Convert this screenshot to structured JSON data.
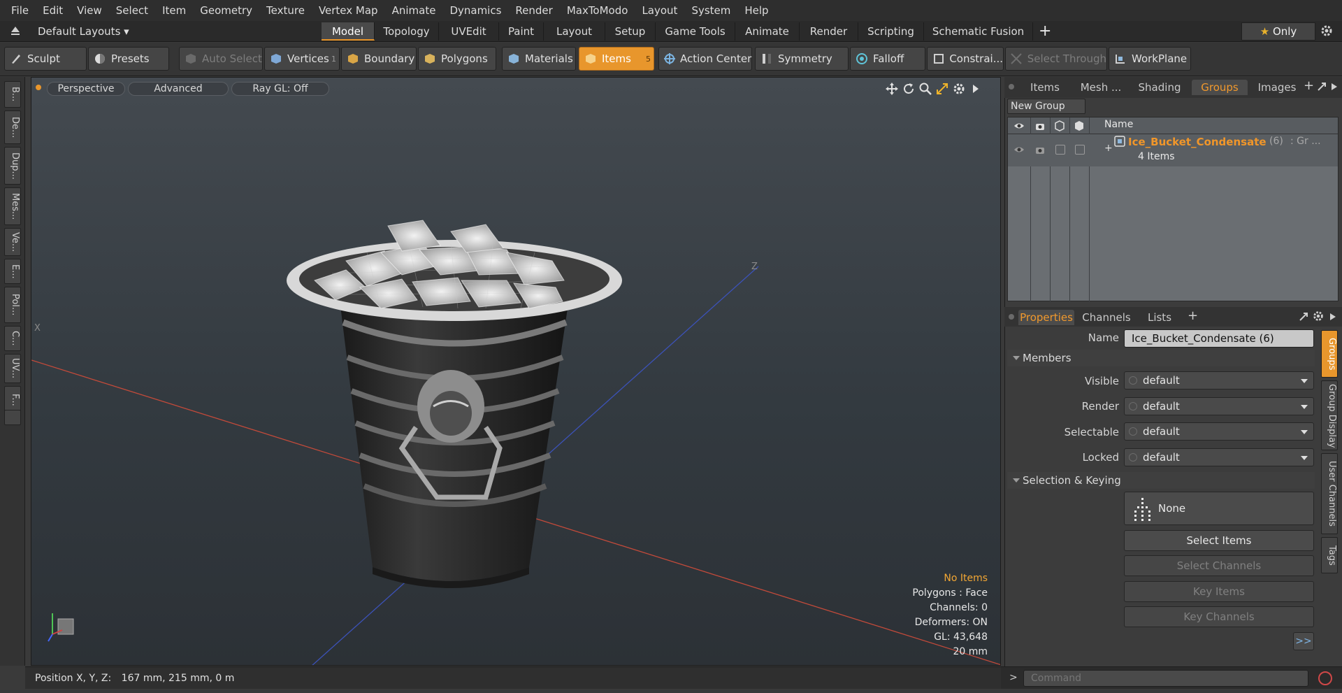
{
  "menu": [
    "File",
    "Edit",
    "View",
    "Select",
    "Item",
    "Geometry",
    "Texture",
    "Vertex Map",
    "Animate",
    "Dynamics",
    "Render",
    "MaxToModo",
    "Layout",
    "System",
    "Help"
  ],
  "tabbar": {
    "layout_label": "Default Layouts",
    "tabs": [
      "Model",
      "Topology",
      "UVEdit",
      "Paint",
      "Layout",
      "Setup",
      "Game Tools",
      "Animate",
      "Render",
      "Scripting",
      "Schematic Fusion"
    ],
    "active_tab": "Model",
    "plus": "+",
    "only_label": "Only"
  },
  "toolbar": {
    "sculpt": "Sculpt",
    "presets": "Presets",
    "auto_select": "Auto Select",
    "vertices": "Vertices",
    "vertices_count": "1",
    "boundary": "Boundary",
    "polygons": "Polygons",
    "materials": "Materials",
    "items": "Items",
    "items_count": "5",
    "action_center": "Action Center",
    "symmetry": "Symmetry",
    "falloff": "Falloff",
    "constraints": "Constrai...",
    "select_through": "Select Through",
    "workplane": "WorkPlane"
  },
  "left_tabs": [
    "B...",
    "De...",
    "Dup...",
    "Mes...",
    "Ve...",
    "E...",
    "Pol...",
    "C...",
    "UV...",
    "F..."
  ],
  "viewport": {
    "perspective": "Perspective",
    "advanced": "Advanced",
    "raygl": "Ray GL: Off",
    "info": {
      "no_items": "No Items",
      "polygons": "Polygons : Face",
      "channels": "Channels: 0",
      "deformers": "Deformers: ON",
      "gl": "GL: 43,648",
      "scale": "20 mm"
    },
    "axis_z": "Z",
    "axis_x": "X"
  },
  "statusbar": {
    "position_label": "Position X, Y, Z:",
    "position_value": "167 mm, 215 mm, 0 m"
  },
  "command": {
    "placeholder": "Command"
  },
  "top_panel": {
    "tabs": [
      "Items",
      "Mesh ...",
      "Shading",
      "Groups",
      "Images"
    ],
    "active_tab": "Groups",
    "new_group": "New Group",
    "column_name": "Name",
    "group": {
      "name": "Ice_Bucket_Condensate",
      "count": "(6)",
      "suffix": ": Gr ...",
      "sub": "4 Items"
    }
  },
  "props": {
    "tabs": [
      "Properties",
      "Channels",
      "Lists"
    ],
    "active_tab": "Properties",
    "name_label": "Name",
    "name_value": "Ice_Bucket_Condensate (6)",
    "members_header": "Members",
    "visible_label": "Visible",
    "render_label": "Render",
    "selectable_label": "Selectable",
    "locked_label": "Locked",
    "default_value": "default",
    "selection_header": "Selection & Keying",
    "none_label": "None",
    "select_items": "Select Items",
    "select_channels": "Select Channels",
    "key_items": "Key Items",
    "key_channels": "Key Channels",
    "more": ">>",
    "side_tabs": [
      "Groups",
      "Group Display",
      "User Channels",
      "Tags"
    ]
  },
  "colors": {
    "accent": "#e8962c",
    "group_name": "#f0962a"
  }
}
